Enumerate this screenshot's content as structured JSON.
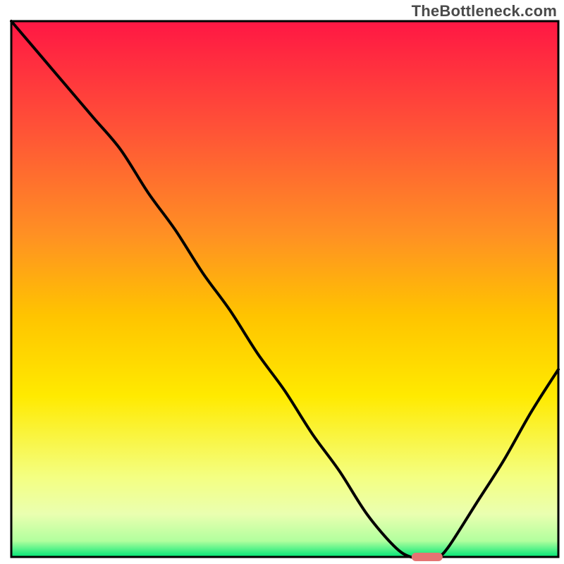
{
  "watermark": "TheBottleneck.com",
  "chart_data": {
    "type": "line",
    "title": "",
    "xlabel": "",
    "ylabel": "",
    "xlim": [
      0,
      100
    ],
    "ylim": [
      0,
      100
    ],
    "grid": false,
    "x": [
      0,
      5,
      10,
      15,
      20,
      25,
      30,
      35,
      40,
      45,
      50,
      55,
      60,
      65,
      70,
      73,
      76,
      78,
      80,
      85,
      90,
      95,
      100
    ],
    "values": [
      100,
      94,
      88,
      82,
      76,
      68,
      61,
      53,
      46,
      38,
      31,
      23,
      16,
      8,
      2,
      0,
      0,
      0,
      2,
      10,
      18,
      27,
      35
    ],
    "marker": {
      "x": 76,
      "y": 0
    },
    "gradient_stops": [
      {
        "offset": 0,
        "color": "#ff1744"
      },
      {
        "offset": 20,
        "color": "#ff5237"
      },
      {
        "offset": 40,
        "color": "#ff9123"
      },
      {
        "offset": 55,
        "color": "#ffc400"
      },
      {
        "offset": 70,
        "color": "#ffea00"
      },
      {
        "offset": 85,
        "color": "#f4ff81"
      },
      {
        "offset": 92,
        "color": "#eaffb0"
      },
      {
        "offset": 97,
        "color": "#b2ff9e"
      },
      {
        "offset": 100,
        "color": "#00e676"
      }
    ],
    "border_color": "#000000"
  }
}
